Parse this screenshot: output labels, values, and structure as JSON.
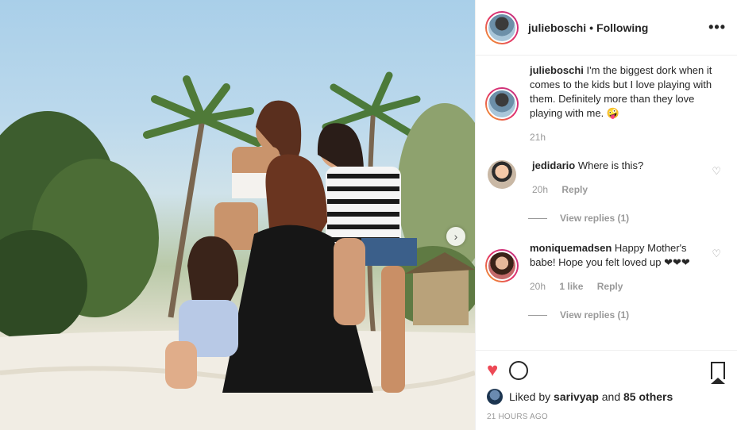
{
  "post": {
    "username": "julieboschi",
    "follow_status": "Following",
    "caption": "I'm the biggest dork when it comes to the kids but I love playing with them. Definitely more than they love playing with me. 🤪",
    "caption_time": "21h",
    "more_icon": "more-horizontal-icon"
  },
  "comments": [
    {
      "username": "jedidario",
      "text": "Where is this?",
      "time": "20h",
      "likes": "",
      "reply_label": "Reply",
      "view_replies": "View replies (1)"
    },
    {
      "username": "moniquemadsen",
      "text": "Happy Mother's babe! Hope you felt loved up ❤❤❤",
      "time": "20h",
      "likes": "1 like",
      "reply_label": "Reply",
      "view_replies": "View replies (1)"
    }
  ],
  "actions": {
    "liked_prefix": "Liked by",
    "liked_user": "sarivyap",
    "liked_and": "and",
    "liked_others": "85 others",
    "timestamp": "21 HOURS AGO"
  },
  "colors": {
    "heart_active": "#ed4956",
    "muted_text": "#999999",
    "story_ring_start": "#f5a623",
    "story_ring_end": "#c13584"
  }
}
